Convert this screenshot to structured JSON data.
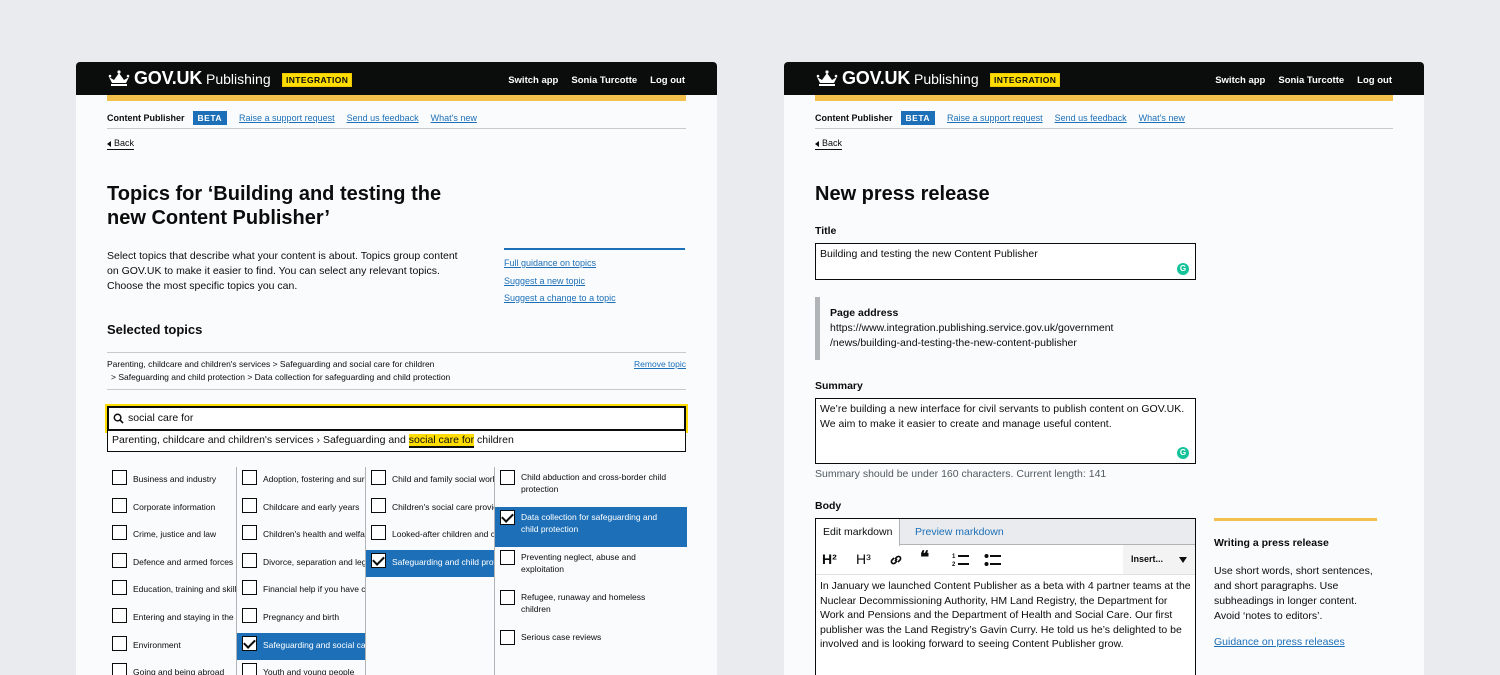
{
  "header": {
    "brand": "GOV.UK",
    "app": "Publishing",
    "env_tag": "INTEGRATION",
    "nav": [
      "Switch app",
      "Sonia Turcotte",
      "Log out"
    ]
  },
  "subnav": {
    "product": "Content Publisher",
    "beta": "BETA",
    "links": [
      "Raise a support request",
      "Send us feedback",
      "What's new"
    ]
  },
  "back_label": "Back",
  "left": {
    "title_line1": "Topics for ‘Building and testing the",
    "title_line2": "new Content Publisher’",
    "intro": [
      "Select topics that describe what your content is about. Topics group content",
      "on GOV.UK to make it easier to find. You can select any relevant topics.",
      "Choose the most specific topics you can."
    ],
    "guidance_links": [
      "Full guidance on topics",
      "Suggest a new topic",
      "Suggest a change to a topic"
    ],
    "selected_heading": "Selected topics",
    "selected_crumb_line1": "Parenting, childcare and children's services  >  Safeguarding and social care for children",
    "selected_crumb_line2": ">  Safeguarding and child protection  >  Data collection for safeguarding and child protection",
    "remove_label": "Remove topic",
    "search_value": "social care for",
    "suggestion_prefix": "Parenting, childcare and children's services › Safeguarding and ",
    "suggestion_match": "social care for",
    "suggestion_suffix": " children",
    "columns": [
      {
        "items": [
          {
            "label": "Business and industry",
            "checked": false
          },
          {
            "label": "Corporate information",
            "checked": false
          },
          {
            "label": "Crime, justice and law",
            "checked": false
          },
          {
            "label": "Defence and armed forces",
            "checked": false
          },
          {
            "label": "Education, training and skills",
            "checked": false
          },
          {
            "label": "Entering and staying in the UK",
            "checked": false
          },
          {
            "label": "Environment",
            "checked": false
          },
          {
            "label": "Going and being abroad",
            "checked": false
          }
        ]
      },
      {
        "items": [
          {
            "label": "Adoption, fostering and surrogacy",
            "checked": false
          },
          {
            "label": "Childcare and early years",
            "checked": false
          },
          {
            "label": "Children's health and welfare",
            "checked": false
          },
          {
            "label": "Divorce, separation and legal issues",
            "checked": false
          },
          {
            "label": "Financial help if you have children",
            "checked": false
          },
          {
            "label": "Pregnancy and birth",
            "checked": false
          },
          {
            "label": "Safeguarding and social care for children",
            "checked": true
          },
          {
            "label": "Youth and young people",
            "checked": false
          }
        ]
      },
      {
        "items": [
          {
            "label": "Child and family social work",
            "checked": false
          },
          {
            "label": "Children's social care providers",
            "checked": false
          },
          {
            "label": "Looked-after children and care leavers",
            "checked": false
          },
          {
            "label": "Safeguarding and child protection",
            "checked": true
          }
        ]
      },
      {
        "items": [
          {
            "label": "Child abduction and cross-border child protection",
            "checked": false
          },
          {
            "label": "Data collection for safeguarding and child protection",
            "checked": true
          },
          {
            "label": "Preventing neglect, abuse and exploitation",
            "checked": false
          },
          {
            "label": "Refugee, runaway and homeless children",
            "checked": false
          },
          {
            "label": "Serious case reviews",
            "checked": false
          }
        ]
      }
    ]
  },
  "right": {
    "title": "New press release",
    "title_label": "Title",
    "title_value": "Building and testing the new Content Publisher",
    "page_address_label": "Page address",
    "page_address_line1": "https://www.integration.publishing.service.gov.uk/government",
    "page_address_line2": "/news/building-and-testing-the-new-content-publisher",
    "summary_label": "Summary",
    "summary_value": "We’re building a new interface for civil servants to publish content on GOV.UK. We aim to make it easier to create and manage useful content.",
    "summary_hint": "Summary should be under 160 characters. Current length: 141",
    "body_label": "Body",
    "tab_edit": "Edit markdown",
    "tab_preview": "Preview markdown",
    "toolbar": {
      "h2": "H²",
      "h3": "H³",
      "link_glyph": "🔗",
      "quote_glyph": "❝",
      "insert": "Insert..."
    },
    "body_value": "In January we launched Content Publisher as a beta with 4 partner teams at the Nuclear Decommissioning Authority, HM Land Registry, the Department for Work and Pensions and the Department of Health and Social Care. Our first publisher was the Land Registry’s Gavin Curry. He told us he’s delighted to be involved and is looking forward to seeing Content Publisher grow.",
    "sidebar_title": "Writing a press release",
    "sidebar_text": "Use short words, short sentences, and short paragraphs. Use subheadings in longer content. Avoid ‘notes to editors’.",
    "sidebar_link": "Guidance on press releases"
  }
}
